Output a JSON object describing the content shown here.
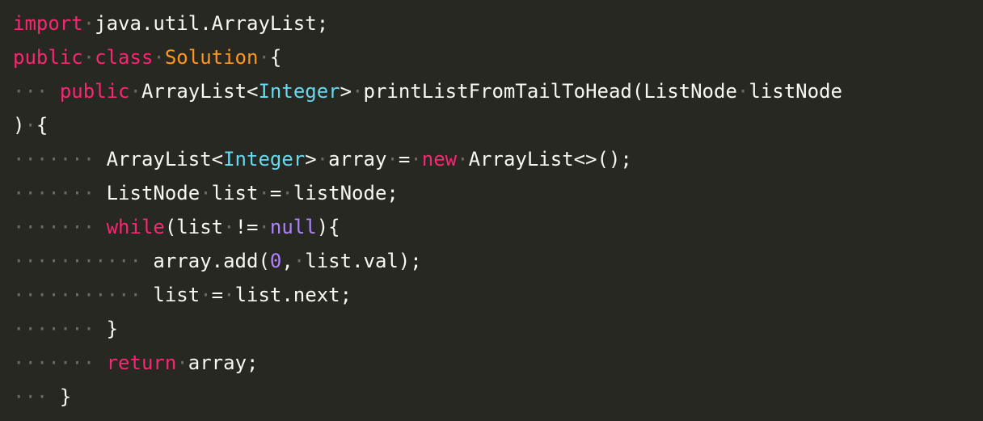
{
  "theme": {
    "background": "#272822",
    "foreground": "#f8f8f2",
    "keyword": "#f92672",
    "class_name": "#fd971f",
    "type": "#66d9ef",
    "number": "#ae81ff",
    "whitespace_marker": "#6a6a60"
  },
  "code": {
    "lines": [
      [
        {
          "t": "kw",
          "v": "import"
        },
        {
          "t": "ws",
          "v": "·"
        },
        {
          "t": "plain",
          "v": "java.util.ArrayList;"
        }
      ],
      [
        {
          "t": "kw",
          "v": "public"
        },
        {
          "t": "ws",
          "v": "·"
        },
        {
          "t": "kw",
          "v": "class"
        },
        {
          "t": "ws",
          "v": "·"
        },
        {
          "t": "cls",
          "v": "Solution"
        },
        {
          "t": "ws",
          "v": "·"
        },
        {
          "t": "plain",
          "v": "{"
        }
      ],
      [
        {
          "t": "ws",
          "v": "···"
        },
        {
          "t": "plain",
          "v": " "
        },
        {
          "t": "kw",
          "v": "public"
        },
        {
          "t": "ws",
          "v": "·"
        },
        {
          "t": "plain",
          "v": "ArrayList<"
        },
        {
          "t": "type",
          "v": "Integer"
        },
        {
          "t": "plain",
          "v": ">"
        },
        {
          "t": "ws",
          "v": "·"
        },
        {
          "t": "plain",
          "v": "printListFromTailToHead(ListNode"
        },
        {
          "t": "ws",
          "v": "·"
        },
        {
          "t": "plain",
          "v": "listNode"
        }
      ],
      [
        {
          "t": "plain",
          "v": ")"
        },
        {
          "t": "ws",
          "v": "·"
        },
        {
          "t": "plain",
          "v": "{"
        }
      ],
      [
        {
          "t": "ws",
          "v": "·······"
        },
        {
          "t": "plain",
          "v": " "
        },
        {
          "t": "plain",
          "v": "ArrayList<"
        },
        {
          "t": "type",
          "v": "Integer"
        },
        {
          "t": "plain",
          "v": ">"
        },
        {
          "t": "ws",
          "v": "·"
        },
        {
          "t": "plain",
          "v": "array"
        },
        {
          "t": "ws",
          "v": "·"
        },
        {
          "t": "plain",
          "v": "="
        },
        {
          "t": "ws",
          "v": "·"
        },
        {
          "t": "kw",
          "v": "new"
        },
        {
          "t": "ws",
          "v": "·"
        },
        {
          "t": "plain",
          "v": "ArrayList<>();"
        }
      ],
      [
        {
          "t": "ws",
          "v": "·······"
        },
        {
          "t": "plain",
          "v": " "
        },
        {
          "t": "plain",
          "v": "ListNode"
        },
        {
          "t": "ws",
          "v": "·"
        },
        {
          "t": "plain",
          "v": "list"
        },
        {
          "t": "ws",
          "v": "·"
        },
        {
          "t": "plain",
          "v": "="
        },
        {
          "t": "ws",
          "v": "·"
        },
        {
          "t": "plain",
          "v": "listNode;"
        }
      ],
      [
        {
          "t": "ws",
          "v": "·······"
        },
        {
          "t": "plain",
          "v": " "
        },
        {
          "t": "kw",
          "v": "while"
        },
        {
          "t": "plain",
          "v": "(list"
        },
        {
          "t": "ws",
          "v": "·"
        },
        {
          "t": "plain",
          "v": "!="
        },
        {
          "t": "ws",
          "v": "·"
        },
        {
          "t": "num",
          "v": "null"
        },
        {
          "t": "plain",
          "v": "){"
        }
      ],
      [
        {
          "t": "ws",
          "v": "···········"
        },
        {
          "t": "plain",
          "v": " "
        },
        {
          "t": "plain",
          "v": "array.add("
        },
        {
          "t": "num",
          "v": "0"
        },
        {
          "t": "plain",
          "v": ","
        },
        {
          "t": "ws",
          "v": "·"
        },
        {
          "t": "plain",
          "v": "list.val);"
        }
      ],
      [
        {
          "t": "ws",
          "v": "···········"
        },
        {
          "t": "plain",
          "v": " "
        },
        {
          "t": "plain",
          "v": "list"
        },
        {
          "t": "ws",
          "v": "·"
        },
        {
          "t": "plain",
          "v": "="
        },
        {
          "t": "ws",
          "v": "·"
        },
        {
          "t": "plain",
          "v": "list.next;"
        }
      ],
      [
        {
          "t": "ws",
          "v": "·······"
        },
        {
          "t": "plain",
          "v": " "
        },
        {
          "t": "plain",
          "v": "}"
        }
      ],
      [
        {
          "t": "ws",
          "v": "·······"
        },
        {
          "t": "plain",
          "v": " "
        },
        {
          "t": "kw",
          "v": "return"
        },
        {
          "t": "ws",
          "v": "·"
        },
        {
          "t": "plain",
          "v": "array;"
        }
      ],
      [
        {
          "t": "ws",
          "v": "···"
        },
        {
          "t": "plain",
          "v": " "
        },
        {
          "t": "plain",
          "v": "}"
        }
      ]
    ]
  }
}
